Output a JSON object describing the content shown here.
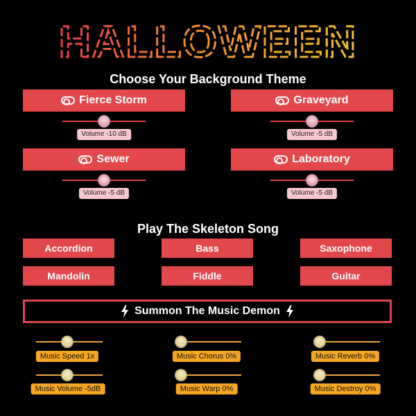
{
  "title": "HALLOWEEN",
  "theme_section": {
    "heading": "Choose Your Background Theme",
    "themes": [
      {
        "label": "Fierce Storm",
        "volume": "Volume -10 dB"
      },
      {
        "label": "Graveyard",
        "volume": "Volume -5 dB"
      },
      {
        "label": "Sewer",
        "volume": "Volume -5 dB"
      },
      {
        "label": "Laboratory",
        "volume": "Volume -5 dB"
      }
    ]
  },
  "song_section": {
    "heading": "Play The Skeleton Song",
    "instruments": [
      "Accordion",
      "Bass",
      "Saxophone",
      "Mandolin",
      "Fiddle",
      "Guitar"
    ]
  },
  "summon_label": "Summon The Music Demon",
  "music_sliders": [
    {
      "label": "Music Speed 1x"
    },
    {
      "label": "Music Chorus 0%"
    },
    {
      "label": "Music Reverb 0%"
    },
    {
      "label": "Music Volume -5dB"
    },
    {
      "label": "Music Warp 0%"
    },
    {
      "label": "Music Destroy 0%"
    }
  ],
  "colors": {
    "accent_red": "#e2474c",
    "accent_orange": "#f5a623",
    "title_yellow": "#f2c230",
    "background": "#000000"
  },
  "icons": {
    "theme_toggle": "toggle-icon",
    "summon": "lightning-bolt-icon"
  }
}
